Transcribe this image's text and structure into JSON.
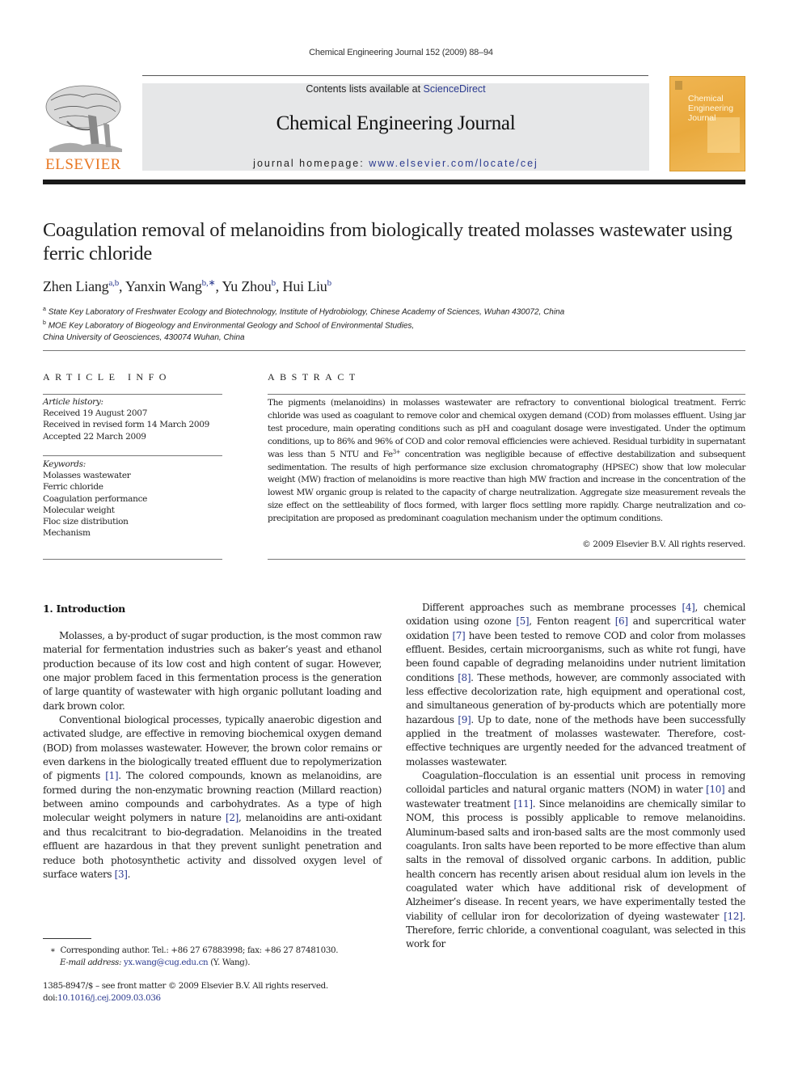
{
  "running_head": "Chemical Engineering Journal 152 (2009) 88–94",
  "masthead": {
    "publisher_logo_text": "ELSEVIER",
    "contents_prefix": "Contents lists available at ",
    "contents_link": "ScienceDirect",
    "journal_name": "Chemical Engineering Journal",
    "homepage_prefix": "journal homepage: ",
    "homepage_link": "www.elsevier.com/locate/cej",
    "cover_title_lines": [
      "Chemical",
      "Engineering",
      "Journal"
    ]
  },
  "colors": {
    "link": "#2b3a8f",
    "elsevier_orange": "#e87722",
    "masthead_bg": "#e6e7e8",
    "cover": "#eeb14a"
  },
  "article": {
    "title": "Coagulation removal of melanoidins from biologically treated molasses wastewater using ferric chloride",
    "authors": [
      {
        "name": "Zhen Liang",
        "sup": "a,b"
      },
      {
        "name": "Yanxin Wang",
        "sup": "b,∗"
      },
      {
        "name": "Yu Zhou",
        "sup": "b"
      },
      {
        "name": "Hui Liu",
        "sup": "b"
      }
    ],
    "affiliations": [
      {
        "mark": "a",
        "text": "State Key Laboratory of Freshwater Ecology and Biotechnology, Institute of Hydrobiology, Chinese Academy of Sciences, Wuhan 430072, China"
      },
      {
        "mark": "b",
        "text": "MOE Key Laboratory of Biogeology and Environmental Geology and School of Environmental Studies,"
      },
      {
        "mark": "",
        "text": "China University of Geosciences, 430074 Wuhan, China"
      }
    ]
  },
  "article_info": {
    "heading": "ARTICLE INFO",
    "history_label": "Article history:",
    "history": [
      "Received 19 August 2007",
      "Received in revised form 14 March 2009",
      "Accepted 22 March 2009"
    ],
    "keywords_label": "Keywords:",
    "keywords": [
      "Molasses wastewater",
      "Ferric chloride",
      "Coagulation performance",
      "Molecular weight",
      "Floc size distribution",
      "Mechanism"
    ]
  },
  "abstract": {
    "heading": "ABSTRACT",
    "text_part1": "The pigments (melanoidins) in molasses wastewater are refractory to conventional biological treatment. Ferric chloride was used as coagulant to remove color and chemical oxygen demand (COD) from molasses effluent. Using jar test procedure, main operating conditions such as pH and coagulant dosage were investigated. Under the optimum conditions, up to 86% and 96% of COD and color removal efficiencies were achieved. Residual turbidity in supernatant was less than 5 NTU and Fe",
    "text_sup": "3+",
    "text_part2": " concentration was negligible because of effective destabilization and subsequent sedimentation. The results of high performance size exclusion chromatography (HPSEC) show that low molecular weight (MW) fraction of melanoidins is more reactive than high MW fraction and increase in the concentration of the lowest MW organic group is related to the capacity of charge neutralization. Aggregate size measurement reveals the size effect on the settleability of flocs formed, with larger flocs settling more rapidly. Charge neutralization and co-precipitation are proposed as predominant coagulation mechanism under the optimum conditions.",
    "copyright": "© 2009 Elsevier B.V. All rights reserved."
  },
  "introduction": {
    "heading": "1.  Introduction",
    "left_paragraphs": [
      [
        {
          "t": "Molasses, a by-product of sugar production, is the most common raw material for fermentation industries such as baker’s yeast and ethanol production because of its low cost and high content of sugar. However, one major problem faced in this fermentation process is the generation of large quantity of wastewater with high organic pollutant loading and dark brown color."
        }
      ],
      [
        {
          "t": "Conventional biological processes, typically anaerobic digestion and activated sludge, are effective in removing biochemical oxygen demand (BOD) from molasses wastewater. However, the brown color remains or even darkens in the biologically treated effluent due to repolymerization of pigments "
        },
        {
          "ref": "[1]"
        },
        {
          "t": ". The colored compounds, known as melanoidins, are formed during the non-enzymatic browning reaction (Millard reaction) between amino compounds and carbohydrates. As a type of high molecular weight polymers in nature "
        },
        {
          "ref": "[2]"
        },
        {
          "t": ", melanoidins are anti-oxidant and thus recalcitrant to bio-degradation. Melanoidins in the treated effluent are hazardous in that they prevent sunlight penetration and reduce both photosynthetic activity and dissolved oxygen level of surface waters "
        },
        {
          "ref": "[3]"
        },
        {
          "t": "."
        }
      ]
    ],
    "right_paragraphs": [
      [
        {
          "t": "Different approaches such as membrane processes "
        },
        {
          "ref": "[4]"
        },
        {
          "t": ", chemical oxidation using ozone "
        },
        {
          "ref": "[5]"
        },
        {
          "t": ", Fenton reagent "
        },
        {
          "ref": "[6]"
        },
        {
          "t": " and supercritical water oxidation "
        },
        {
          "ref": "[7]"
        },
        {
          "t": " have been tested to remove COD and color from molasses effluent. Besides, certain microorganisms, such as white rot fungi, have been found capable of degrading melanoidins under nutrient limitation conditions "
        },
        {
          "ref": "[8]"
        },
        {
          "t": ". These methods, however, are commonly associated with less effective decolorization rate, high equipment and operational cost, and simultaneous generation of by-products which are potentially more hazardous "
        },
        {
          "ref": "[9]"
        },
        {
          "t": ". Up to date, none of the methods have been successfully applied in the treatment of molasses wastewater. Therefore, cost-effective techniques are urgently needed for the advanced treatment of molasses wastewater."
        }
      ],
      [
        {
          "t": "Coagulation–flocculation is an essential unit process in removing colloidal particles and natural organic matters (NOM) in water "
        },
        {
          "ref": "[10]"
        },
        {
          "t": " and wastewater treatment "
        },
        {
          "ref": "[11]"
        },
        {
          "t": ". Since melanoidins are chemically similar to NOM, this process is possibly applicable to remove melanoidins. Aluminum-based salts and iron-based salts are the most commonly used coagulants. Iron salts have been reported to be more effective than alum salts in the removal of dissolved organic carbons. In addition, public health concern has recently arisen about residual alum ion levels in the coagulated water which have additional risk of development of Alzheimer’s disease. In recent years, we have experimentally tested the viability of cellular iron for decolorization of dyeing wastewater "
        },
        {
          "ref": "[12]"
        },
        {
          "t": ". Therefore, ferric chloride, a conventional coagulant, was selected in this work for"
        }
      ]
    ]
  },
  "footnote": {
    "mark": "∗",
    "corresponding": "Corresponding author. Tel.: +86 27 67883998; fax: +86 27 87481030.",
    "email_label": "E-mail address: ",
    "email": "yx.wang@cug.edu.cn",
    "email_suffix": " (Y. Wang)."
  },
  "front_matter": {
    "issn_line": "1385-8947/$ – see front matter © 2009 Elsevier B.V. All rights reserved.",
    "doi_prefix": "doi:",
    "doi": "10.1016/j.cej.2009.03.036"
  }
}
